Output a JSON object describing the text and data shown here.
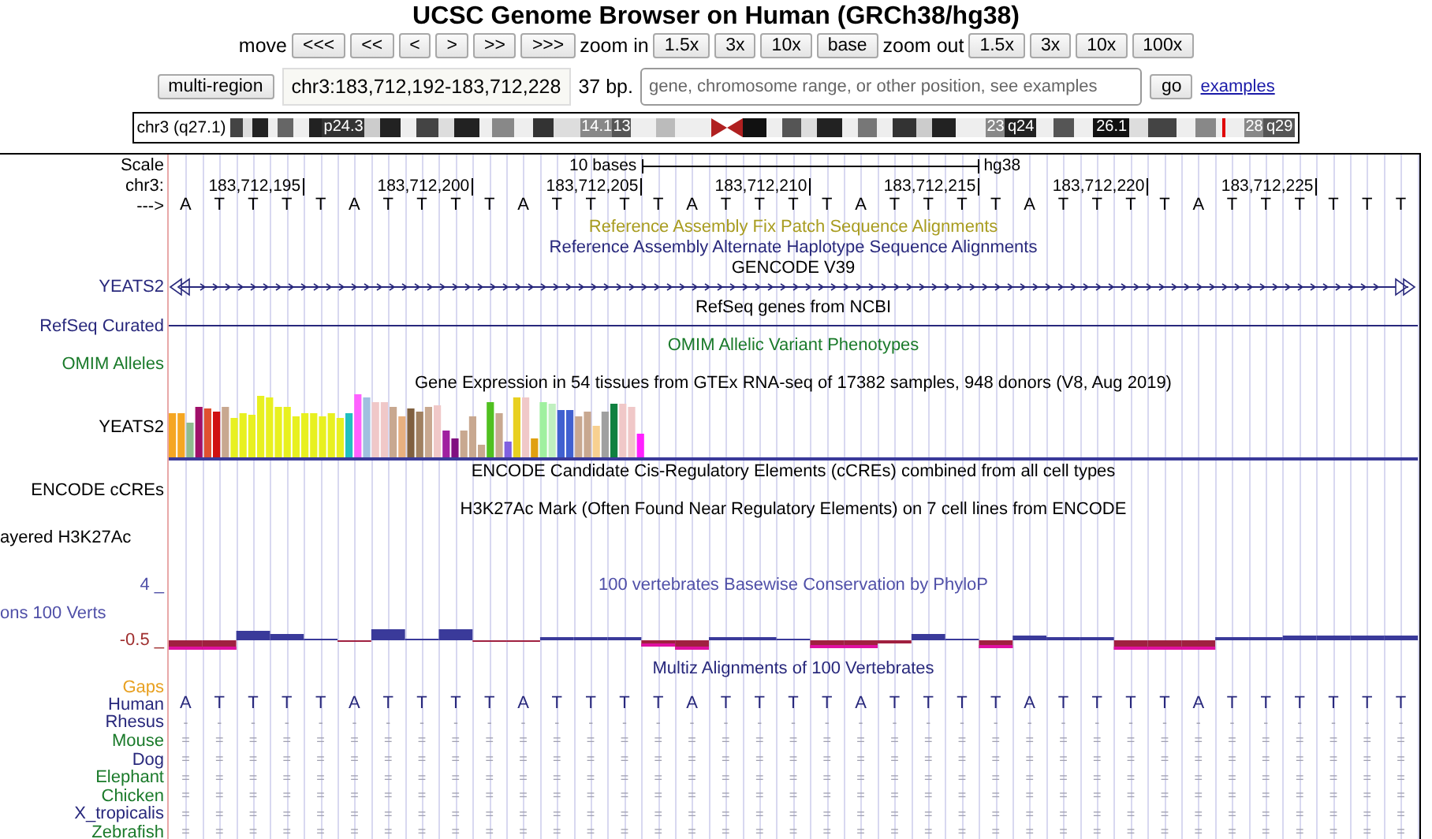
{
  "header": {
    "title": "UCSC Genome Browser on Human (GRCh38/hg38)",
    "move_label": "move",
    "move_buttons": [
      "<<<",
      "<<",
      "<",
      ">",
      ">>",
      ">>>"
    ],
    "zoom_in_label": "zoom in",
    "zoom_in_buttons": [
      "1.5x",
      "3x",
      "10x",
      "base"
    ],
    "zoom_out_label": "zoom out",
    "zoom_out_buttons": [
      "1.5x",
      "3x",
      "10x",
      "100x"
    ],
    "multi_region_button": "multi-region",
    "position": "chr3:183,712,192-183,712,228",
    "size": "37 bp.",
    "search": {
      "placeholder": "gene, chromosome range, or other position, see examples"
    },
    "go_button": "go",
    "examples_link": "examples"
  },
  "ideogram": {
    "label": "chr3 (q27.1)",
    "band_labels": [
      "p24.3",
      "14.1",
      "13",
      "23",
      "q24",
      "26.1",
      "28",
      "q29"
    ]
  },
  "tracks": [
    {
      "kind": "scale",
      "label": "Scale",
      "bar_label": "10 bases",
      "assembly": "hg38"
    },
    {
      "kind": "ruler",
      "label": "chr3:",
      "positions": [
        "183,712,195",
        "183,712,200",
        "183,712,205",
        "183,712,210",
        "183,712,215",
        "183,712,220",
        "183,712,225"
      ]
    },
    {
      "kind": "bases",
      "label": "--->",
      "bases": [
        "A",
        "T",
        "T",
        "T",
        "T",
        "A",
        "T",
        "T",
        "T",
        "T",
        "A",
        "T",
        "T",
        "T",
        "T",
        "A",
        "T",
        "T",
        "T",
        "T",
        "A",
        "T",
        "T",
        "T",
        "T",
        "A",
        "T",
        "T",
        "T",
        "T",
        "A",
        "T",
        "T",
        "T",
        "T",
        "T",
        "T"
      ]
    },
    {
      "kind": "title",
      "text": "Reference Assembly Fix Patch Sequence Alignments",
      "color": "#a89c20"
    },
    {
      "kind": "title",
      "text": "Reference Assembly Alternate Haplotype Sequence Alignments",
      "color": "#28287c"
    },
    {
      "kind": "title",
      "text": "GENCODE V39",
      "color": "#000000"
    },
    {
      "kind": "gene",
      "label": "YEATS2",
      "color": "#28287c"
    },
    {
      "kind": "title",
      "text": "RefSeq genes from NCBI",
      "color": "#000000"
    },
    {
      "kind": "line",
      "label": "RefSeq Curated",
      "color": "#28287c"
    },
    {
      "kind": "title",
      "text": "OMIM Allelic Variant Phenotypes",
      "color": "#1a7a2a"
    },
    {
      "kind": "label",
      "label": "OMIM Alleles",
      "color": "#1a7a2a"
    },
    {
      "kind": "title",
      "text": "Gene Expression in 54 tissues from GTEx RNA-seq of 17382 samples, 948 donors (V8, Aug 2019)",
      "color": "#000000"
    },
    {
      "kind": "expression",
      "label": "YEATS2",
      "color": "#000000"
    },
    {
      "kind": "title",
      "text": "ENCODE Candidate Cis-Regulatory Elements (cCREs) combined from all cell types",
      "color": "#000000"
    },
    {
      "kind": "label",
      "label": "ENCODE cCREs",
      "color": "#000000"
    },
    {
      "kind": "title",
      "text": "H3K27Ac Mark (Often Found Near Regulatory Elements) on 7 cell lines from ENCODE",
      "color": "#000000"
    },
    {
      "kind": "cut_label",
      "label": "ayered H3K27Ac",
      "color": "#000000"
    },
    {
      "kind": "axis_title",
      "axis": "4 _",
      "text": "100 vertebrates Basewise Conservation by PhyloP",
      "color": "#5050a8"
    },
    {
      "kind": "cut_label",
      "label": "ons 100 Verts",
      "color": "#5050a8"
    },
    {
      "kind": "phylop",
      "axis": "-0.5 _",
      "color": "#a03030"
    },
    {
      "kind": "title",
      "text": "Multiz Alignments of 100 Vertebrates",
      "color": "#28287c"
    },
    {
      "kind": "label",
      "label": "Gaps",
      "color": "#e8a020"
    },
    {
      "kind": "alignment",
      "label": "Human",
      "color": "#28287c",
      "bases": [
        "A",
        "T",
        "T",
        "T",
        "T",
        "A",
        "T",
        "T",
        "T",
        "T",
        "A",
        "T",
        "T",
        "T",
        "T",
        "A",
        "T",
        "T",
        "T",
        "T",
        "A",
        "T",
        "T",
        "T",
        "T",
        "A",
        "T",
        "T",
        "T",
        "T",
        "A",
        "T",
        "T",
        "T",
        "T",
        "T",
        "T"
      ]
    },
    {
      "kind": "alignment",
      "label": "Rhesus",
      "color": "#28287c",
      "bases": [
        "-",
        "-",
        "-",
        "-",
        "-",
        "-",
        "-",
        "-",
        "-",
        "-",
        "-",
        "-",
        "-",
        "-",
        "-",
        "-",
        "-",
        "-",
        "-",
        "-",
        "-",
        "-",
        "-",
        "-",
        "-",
        "-",
        "-",
        "-",
        "-",
        "-",
        "-",
        "-",
        "-",
        "-",
        "-",
        "-",
        "-"
      ]
    },
    {
      "kind": "alignment",
      "label": "Mouse",
      "color": "#1a7a2a",
      "bases": [
        "=",
        "=",
        "=",
        "=",
        "=",
        "=",
        "=",
        "=",
        "=",
        "=",
        "=",
        "=",
        "=",
        "=",
        "=",
        "=",
        "=",
        "=",
        "=",
        "=",
        "=",
        "=",
        "=",
        "=",
        "=",
        "=",
        "=",
        "=",
        "=",
        "=",
        "=",
        "=",
        "=",
        "=",
        "=",
        "=",
        "="
      ]
    },
    {
      "kind": "alignment",
      "label": "Dog",
      "color": "#28287c",
      "bases": [
        "=",
        "=",
        "=",
        "=",
        "=",
        "=",
        "=",
        "=",
        "=",
        "=",
        "=",
        "=",
        "=",
        "=",
        "=",
        "=",
        "=",
        "=",
        "=",
        "=",
        "=",
        "=",
        "=",
        "=",
        "=",
        "=",
        "=",
        "=",
        "=",
        "=",
        "=",
        "=",
        "=",
        "=",
        "=",
        "=",
        "="
      ]
    },
    {
      "kind": "alignment",
      "label": "Elephant",
      "color": "#1a7a2a",
      "bases": [
        "=",
        "=",
        "=",
        "=",
        "=",
        "=",
        "=",
        "=",
        "=",
        "=",
        "=",
        "=",
        "=",
        "=",
        "=",
        "=",
        "=",
        "=",
        "=",
        "=",
        "=",
        "=",
        "=",
        "=",
        "=",
        "=",
        "=",
        "=",
        "=",
        "=",
        "=",
        "=",
        "=",
        "=",
        "=",
        "=",
        "="
      ]
    },
    {
      "kind": "alignment",
      "label": "Chicken",
      "color": "#1a7a2a",
      "bases": [
        "=",
        "=",
        "=",
        "=",
        "=",
        "=",
        "=",
        "=",
        "=",
        "=",
        "=",
        "=",
        "=",
        "=",
        "=",
        "=",
        "=",
        "=",
        "=",
        "=",
        "=",
        "=",
        "=",
        "=",
        "=",
        "=",
        "=",
        "=",
        "=",
        "=",
        "=",
        "=",
        "=",
        "=",
        "=",
        "=",
        "="
      ]
    },
    {
      "kind": "alignment",
      "label": "X_tropicalis",
      "color": "#28287c",
      "bases": [
        "=",
        "=",
        "=",
        "=",
        "=",
        "=",
        "=",
        "=",
        "=",
        "=",
        "=",
        "=",
        "=",
        "=",
        "=",
        "=",
        "=",
        "=",
        "=",
        "=",
        "=",
        "=",
        "=",
        "=",
        "=",
        "=",
        "=",
        "=",
        "=",
        "=",
        "=",
        "=",
        "=",
        "=",
        "=",
        "=",
        "="
      ]
    },
    {
      "kind": "alignment",
      "label": "Zebrafish",
      "color": "#1a7a2a",
      "bases": [
        "=",
        "=",
        "=",
        "=",
        "=",
        "=",
        "=",
        "=",
        "=",
        "=",
        "=",
        "=",
        "=",
        "=",
        "=",
        "=",
        "=",
        "=",
        "=",
        "=",
        "=",
        "=",
        "=",
        "=",
        "=",
        "=",
        "=",
        "=",
        "=",
        "=",
        "=",
        "=",
        "=",
        "=",
        "=",
        "=",
        "="
      ]
    }
  ]
}
